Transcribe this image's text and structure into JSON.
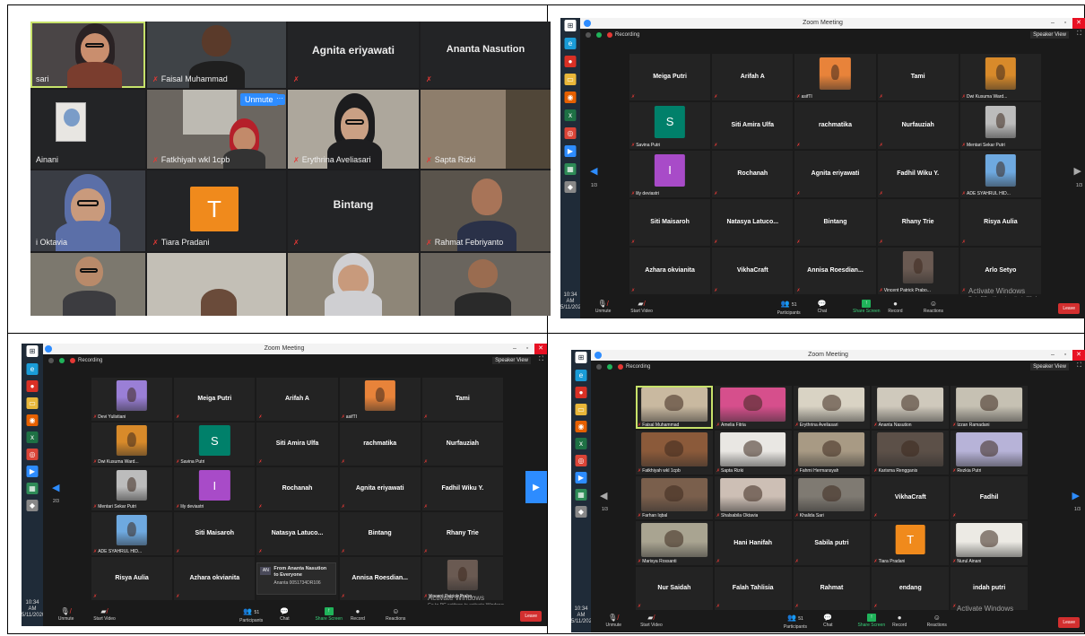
{
  "panel1": {
    "names": {
      "sari": "sari",
      "faisal": "Faisal Muhammad",
      "agnita": "Agnita eriyawati",
      "ananta": "Ananta Nasution",
      "ainani": "Ainani",
      "fatkhiyah": "Fatkhiyah wkl 1cpb",
      "erythrina": "Erythrina Aveliasari",
      "sapta": "Sapta Rizki",
      "oktavia": "i Oktavia",
      "tiara": "Tiara Pradani",
      "bintang": "Bintang",
      "rahmat": "Rahmat Febriyanto"
    },
    "avatar_letter": "T",
    "unmute_label": "Unmute",
    "more_label": "···"
  },
  "common": {
    "window_title": "Zoom Meeting",
    "recording": "Recording",
    "speaker_view": "Speaker View",
    "clock_time": "10:34 AM",
    "clock_date": "5/11/2020",
    "activate_title": "Activate Windows",
    "activate_sub": "Go to PC settings to activate Windows.",
    "toolbar": {
      "unmute": "Unmute",
      "start_video": "Start Video",
      "participants": "Participants",
      "participants_count": "51",
      "chat": "Chat",
      "share": "Share Screen",
      "record": "Record",
      "reactions": "Reactions",
      "leave": "Leave"
    }
  },
  "panel2": {
    "page": "1/3",
    "tiles": [
      {
        "name": "Meiga Putri",
        "type": "name"
      },
      {
        "name": "Arifah A",
        "type": "name"
      },
      {
        "name": "asifTI",
        "type": "video",
        "color": "#e8833a"
      },
      {
        "name": "Tami",
        "type": "name"
      },
      {
        "name": "Dwi Kusuma Ward...",
        "type": "video",
        "color": "#d88a2a"
      },
      {
        "name": "Savina Putri",
        "type": "avatar",
        "letter": "S",
        "color": "#00806a"
      },
      {
        "name": "Siti Amira Ulfa",
        "type": "name"
      },
      {
        "name": "rachmatika",
        "type": "name"
      },
      {
        "name": "Nurfauziah",
        "type": "name"
      },
      {
        "name": "Mentari Sekar Putri",
        "type": "video",
        "color": "#bcbcbc"
      },
      {
        "name": "lily deviastri",
        "type": "avatar",
        "letter": "I",
        "color": "#a84bc8"
      },
      {
        "name": "Rochanah",
        "type": "name"
      },
      {
        "name": "Agnita eriyawati",
        "type": "name"
      },
      {
        "name": "Fadhil Wiku Y.",
        "type": "name"
      },
      {
        "name": "ADE SYAHRUL HID...",
        "type": "video",
        "color": "#6ea9e0"
      },
      {
        "name": "Siti Maisaroh",
        "type": "name"
      },
      {
        "name": "Natasya Latuco...",
        "type": "name"
      },
      {
        "name": "Bintang",
        "type": "name"
      },
      {
        "name": "Rhany Trie",
        "type": "name"
      },
      {
        "name": "Risya Aulia",
        "type": "name"
      },
      {
        "name": "Azhara okvianita",
        "type": "name"
      },
      {
        "name": "VikhaCraft",
        "type": "name"
      },
      {
        "name": "Annisa Roesdian...",
        "type": "name"
      },
      {
        "name": "Vincent Patrick Prabo...",
        "type": "video",
        "color": "#6a5a52"
      },
      {
        "name": "Arlo Setyo",
        "type": "name"
      }
    ]
  },
  "panel3": {
    "page": "2/3",
    "chat_from": "From Ananta Nasution to Everyone",
    "chat_msg": "Ananta 0051734DR106",
    "chat_initials": "AN",
    "tiles": [
      {
        "name": "Devi Yulistiani",
        "type": "video",
        "color": "#9a7fd6"
      },
      {
        "name": "Meiga Putri",
        "type": "name"
      },
      {
        "name": "Arifah A",
        "type": "name"
      },
      {
        "name": "asifTI",
        "type": "video",
        "color": "#e8833a"
      },
      {
        "name": "Tami",
        "type": "name"
      },
      {
        "name": "Dwi Kusuma Ward...",
        "type": "video",
        "color": "#d88a2a"
      },
      {
        "name": "Savina Putri",
        "type": "avatar",
        "letter": "S",
        "color": "#00806a"
      },
      {
        "name": "Siti Amira Ulfa",
        "type": "name"
      },
      {
        "name": "rachmatika",
        "type": "name"
      },
      {
        "name": "Nurfauziah",
        "type": "name"
      },
      {
        "name": "Mentari Sekar Putri",
        "type": "video",
        "color": "#bcbcbc"
      },
      {
        "name": "lily deviastri",
        "type": "avatar",
        "letter": "I",
        "color": "#a84bc8"
      },
      {
        "name": "Rochanah",
        "type": "name"
      },
      {
        "name": "Agnita eriyawati",
        "type": "name"
      },
      {
        "name": "Fadhil Wiku Y.",
        "type": "name"
      },
      {
        "name": "ADE SYAHRUL HID...",
        "type": "video",
        "color": "#6ea9e0"
      },
      {
        "name": "Siti Maisaroh",
        "type": "name"
      },
      {
        "name": "Natasya Latuco...",
        "type": "name"
      },
      {
        "name": "Bintang",
        "type": "name"
      },
      {
        "name": "Rhany Trie",
        "type": "name"
      },
      {
        "name": "Risya Aulia",
        "type": "name"
      },
      {
        "name": "Azhara okvianita",
        "type": "name"
      },
      {
        "name": "",
        "type": "chat"
      },
      {
        "name": "Annisa Roesdian...",
        "type": "name"
      },
      {
        "name": "Vincent Patrick Prabo...",
        "type": "video",
        "color": "#6a5a52"
      }
    ]
  },
  "panel4": {
    "page": "1/3",
    "tiles": [
      {
        "name": "Faisal Muhammad",
        "type": "video",
        "color": "#c9b9a0",
        "active": true
      },
      {
        "name": "Amelia Fitria",
        "type": "video",
        "color": "#d64f8c"
      },
      {
        "name": "Erythrina Aveliasari",
        "type": "video",
        "color": "#d9d3c4"
      },
      {
        "name": "Ananta Nasution",
        "type": "video",
        "color": "#cfc9bc"
      },
      {
        "name": "Izzan Ramadani",
        "type": "video",
        "color": "#c6c1b3"
      },
      {
        "name": "Fatkhiyah wkl 1cpb",
        "type": "video",
        "color": "#8b5a3a"
      },
      {
        "name": "Sapta Rizki",
        "type": "video",
        "color": "#e9e7e3"
      },
      {
        "name": "Fahmi Hermansyah",
        "type": "video",
        "color": "#a89a84"
      },
      {
        "name": "Karisma Rengganis",
        "type": "video",
        "color": "#5c5048"
      },
      {
        "name": "Rezkia Putri",
        "type": "video",
        "color": "#b7b3d8"
      },
      {
        "name": "Farhan Iqbal",
        "type": "video",
        "color": "#7a5f4c"
      },
      {
        "name": "Shalsabila Oktavia",
        "type": "video",
        "color": "#cdbfb5"
      },
      {
        "name": "Khalida Sari",
        "type": "video",
        "color": "#7f7a72"
      },
      {
        "name": "VikhaCraft",
        "type": "name"
      },
      {
        "name": "Fadhil",
        "type": "name"
      },
      {
        "name": "Marisya Rossanti",
        "type": "video",
        "color": "#a9a491"
      },
      {
        "name": "Hani Hanifah",
        "type": "name"
      },
      {
        "name": "Sabila putri",
        "type": "name"
      },
      {
        "name": "Tiara Pradani",
        "type": "avatar",
        "letter": "T",
        "color": "#f08a1c"
      },
      {
        "name": "Nurul Ainani",
        "type": "video",
        "color": "#eceae4"
      },
      {
        "name": "Nur Saidah",
        "type": "name"
      },
      {
        "name": "Falah Tahlisia",
        "type": "name"
      },
      {
        "name": "Rahmat",
        "type": "name"
      },
      {
        "name": "endang",
        "type": "name"
      },
      {
        "name": "indah putri",
        "type": "name"
      }
    ]
  },
  "colors": {
    "zoom_blue": "#2d8cff",
    "muted_red": "#e53935",
    "share_green": "#20b35a",
    "leave_red": "#d32f2f",
    "active_speaker": "#c7e26a"
  }
}
